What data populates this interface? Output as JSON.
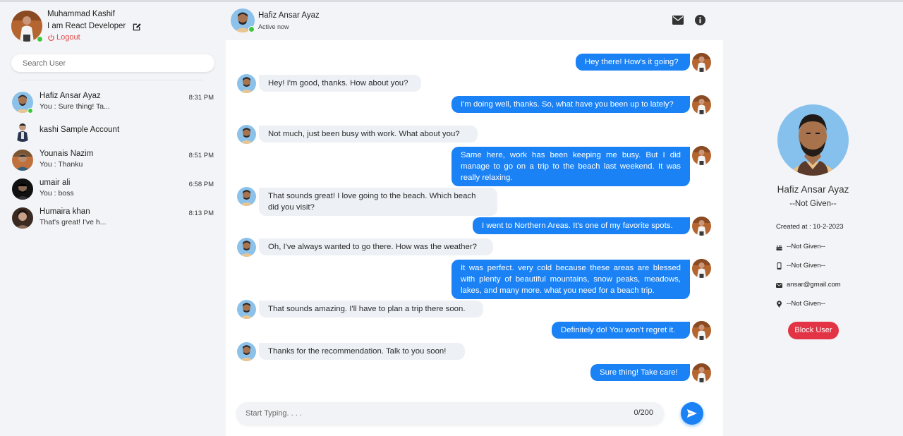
{
  "current_user": {
    "name": "Muhammad Kashif",
    "bio": "I am React Developer",
    "logout_label": "Logout"
  },
  "search": {
    "placeholder": "Search User"
  },
  "contacts": [
    {
      "name": "Hafiz Ansar Ayaz",
      "last_message": "You : Sure thing! Ta...",
      "time": "8:31 PM",
      "online": true
    },
    {
      "name": "kashi Sample Account",
      "last_message": "",
      "time": "",
      "online": false
    },
    {
      "name": "Younais Nazim",
      "last_message": "You : Thanku",
      "time": "8:51 PM",
      "online": false
    },
    {
      "name": "umair ali",
      "last_message": "You : boss",
      "time": "6:58 PM",
      "online": false
    },
    {
      "name": "Humaira khan",
      "last_message": "That's great! I've h...",
      "time": "8:13 PM",
      "online": false
    }
  ],
  "chat": {
    "contact_name": "Hafiz Ansar Ayaz",
    "status": "Active now",
    "messages": [
      {
        "from": "me",
        "text": "Hey there! How's it going?"
      },
      {
        "from": "them",
        "text": "Hey! I'm good, thanks. How about you?"
      },
      {
        "from": "me",
        "text": "I'm doing well, thanks. So, what have you been up to lately?"
      },
      {
        "from": "them",
        "text": "Not much, just been busy with work. What about you?"
      },
      {
        "from": "me",
        "text": "Same here, work has been keeping me busy. But I did manage to go on a trip to the beach last weekend. It was really relaxing."
      },
      {
        "from": "them",
        "text": "That sounds great! I love going to the beach. Which beach did you visit?"
      },
      {
        "from": "me",
        "text": "I went to Northern Areas. It's one of my favorite spots."
      },
      {
        "from": "them",
        "text": "Oh, I've always wanted to go there. How was the weather?"
      },
      {
        "from": "me",
        "text": "It was perfect. very cold because these areas are blessed with plenty of beautiful mountains, snow peaks, meadows, lakes, and many more. what you need for a beach trip."
      },
      {
        "from": "them",
        "text": "That sounds amazing. I'll have to plan a trip there soon."
      },
      {
        "from": "me",
        "text": "Definitely do! You won't regret it."
      },
      {
        "from": "them",
        "text": "Thanks for the recommendation. Talk to you soon!"
      },
      {
        "from": "me",
        "text": "Sure thing! Take care!"
      }
    ],
    "composer_placeholder": "Start Typing. . . .",
    "char_counter": "0/200"
  },
  "profile": {
    "name": "Hafiz Ansar Ayaz",
    "subtitle": "--Not Given--",
    "created_at": "Created at : 10-2-2023",
    "birthday": "--Not Given--",
    "phone": "--Not Given--",
    "email": "ansar@gmail.com",
    "location": "--Not Given--",
    "block_label": "Block User"
  },
  "colors": {
    "accent": "#1a82f5",
    "online": "#3ec43e",
    "danger": "#e23445",
    "logout": "#e04848"
  }
}
